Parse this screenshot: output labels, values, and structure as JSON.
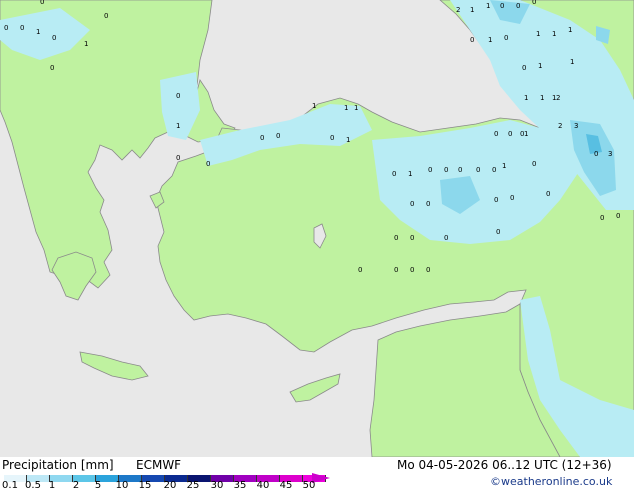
{
  "footer": {
    "title": "Precipitation [mm]",
    "model": "ECMWF",
    "valid_time": "Mo 04-05-2026 06..12 UTC (12+36)",
    "credit": "©weatheronline.co.uk"
  },
  "legend": {
    "ticks": [
      "0.1",
      "0.5",
      "1",
      "2",
      "5",
      "10",
      "15",
      "20",
      "25",
      "30",
      "35",
      "40",
      "45",
      "50"
    ],
    "colors": [
      "#e6f5fb",
      "#bde8f6",
      "#8fd8f0",
      "#5cc6e8",
      "#2ba3dc",
      "#1d78c8",
      "#1548b0",
      "#0b2a90",
      "#0a1470",
      "#7000a8",
      "#a000c0",
      "#c000c8",
      "#dd00cc",
      "#ee00dd"
    ]
  },
  "map_colors": {
    "sea": "#e8e8e8",
    "land": "#bff2a0",
    "coast": "#8a8a8a",
    "precip_light": "#b8ecf4",
    "precip_medium": "#8cd8ec",
    "precip_heavy": "#58bfe2"
  },
  "precip_labels": [
    "0",
    "0",
    "0",
    "0",
    "1",
    "0",
    "0",
    "1",
    "0",
    "1",
    "1",
    "1",
    "1",
    "0",
    "2",
    "1",
    "1",
    "0",
    "0",
    "0",
    "0",
    "1",
    "0",
    "0",
    "1",
    "1",
    "1",
    "1",
    "1",
    "1",
    "1",
    "1",
    "0",
    "0",
    "0",
    "1",
    "0",
    "0",
    "0",
    "0",
    "0",
    "0",
    "1",
    "1",
    "2",
    "2",
    "3",
    "3",
    "0",
    "0",
    "0",
    "0",
    "0",
    "0",
    "0",
    "0",
    "0",
    "0",
    "0",
    "0",
    "0",
    "0",
    "0",
    "0",
    "0",
    "1",
    "0",
    "0",
    "0",
    "0"
  ]
}
